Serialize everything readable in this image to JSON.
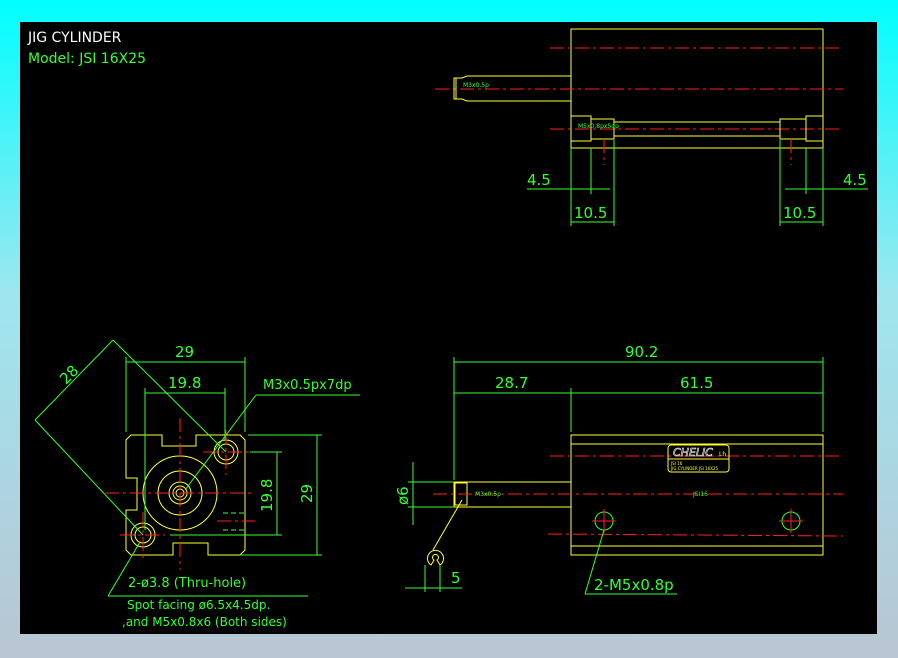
{
  "title": "JIG CYLINDER",
  "model": "Model:  JSI 16X25",
  "colors": {
    "outline": "#ffff33",
    "dimension": "#33ff33",
    "centerline": "#ff2020",
    "background": "#000000"
  },
  "top_view": {
    "rod_thread": "M3x0.5p",
    "port_thread": "M5x0.8px5dp",
    "dims": {
      "left_small": "4.5",
      "left_large": "10.5",
      "right_large": "10.5",
      "right_small": "4.5"
    }
  },
  "front_view": {
    "dims": {
      "diag": "28",
      "width": "29",
      "pitch_h": "19.8",
      "pitch_v": "19.8",
      "height": "29"
    },
    "tap_callout": "M3x0.5px7dp",
    "hole_callout": "2-ø3.8 (Thru-hole)",
    "spot_facing": "Spot facing ø6.5x4.5dp.",
    "both_sides": ",and M5x0.8x6 (Both sides)"
  },
  "side_view": {
    "dims": {
      "overall": "90.2",
      "rod_length": "28.7",
      "body_length": "61.5",
      "rod_dia": "ø6",
      "wrench": "5"
    },
    "rod_thread": "M3x0.5p",
    "brand": "CHELIC",
    "brand_suffix": "Lh",
    "label_line1": "JSI 16",
    "label_line2": "JIG CYLINDER  JSI 16X25",
    "model_mark": "JSI16",
    "port_callout": "2-M5x0.8p"
  }
}
